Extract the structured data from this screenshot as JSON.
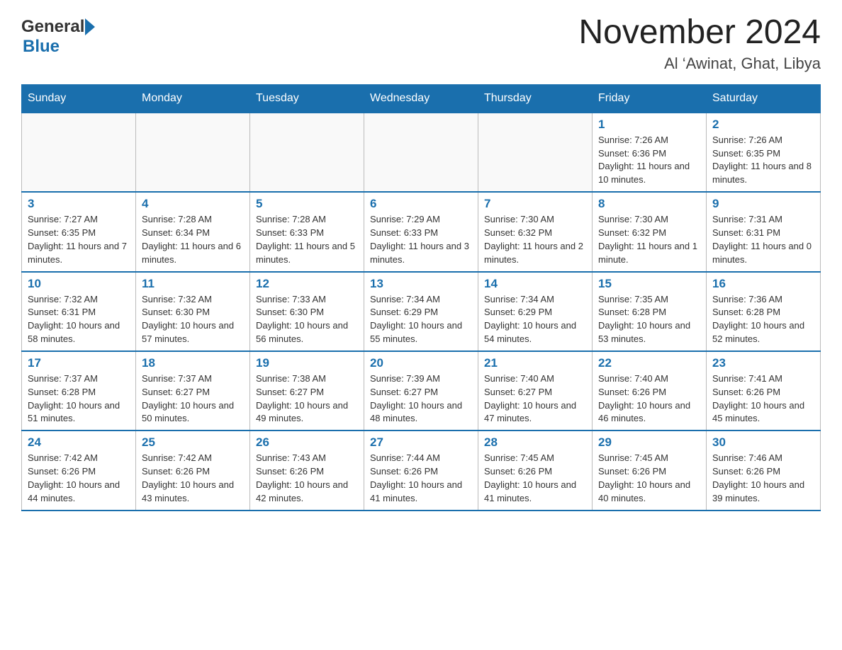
{
  "header": {
    "logo_general": "General",
    "logo_blue": "Blue",
    "month_title": "November 2024",
    "location": "Al ‘Awinat, Ghat, Libya"
  },
  "weekdays": [
    "Sunday",
    "Monday",
    "Tuesday",
    "Wednesday",
    "Thursday",
    "Friday",
    "Saturday"
  ],
  "weeks": [
    [
      {
        "day": "",
        "info": ""
      },
      {
        "day": "",
        "info": ""
      },
      {
        "day": "",
        "info": ""
      },
      {
        "day": "",
        "info": ""
      },
      {
        "day": "",
        "info": ""
      },
      {
        "day": "1",
        "info": "Sunrise: 7:26 AM\nSunset: 6:36 PM\nDaylight: 11 hours and 10 minutes."
      },
      {
        "day": "2",
        "info": "Sunrise: 7:26 AM\nSunset: 6:35 PM\nDaylight: 11 hours and 8 minutes."
      }
    ],
    [
      {
        "day": "3",
        "info": "Sunrise: 7:27 AM\nSunset: 6:35 PM\nDaylight: 11 hours and 7 minutes."
      },
      {
        "day": "4",
        "info": "Sunrise: 7:28 AM\nSunset: 6:34 PM\nDaylight: 11 hours and 6 minutes."
      },
      {
        "day": "5",
        "info": "Sunrise: 7:28 AM\nSunset: 6:33 PM\nDaylight: 11 hours and 5 minutes."
      },
      {
        "day": "6",
        "info": "Sunrise: 7:29 AM\nSunset: 6:33 PM\nDaylight: 11 hours and 3 minutes."
      },
      {
        "day": "7",
        "info": "Sunrise: 7:30 AM\nSunset: 6:32 PM\nDaylight: 11 hours and 2 minutes."
      },
      {
        "day": "8",
        "info": "Sunrise: 7:30 AM\nSunset: 6:32 PM\nDaylight: 11 hours and 1 minute."
      },
      {
        "day": "9",
        "info": "Sunrise: 7:31 AM\nSunset: 6:31 PM\nDaylight: 11 hours and 0 minutes."
      }
    ],
    [
      {
        "day": "10",
        "info": "Sunrise: 7:32 AM\nSunset: 6:31 PM\nDaylight: 10 hours and 58 minutes."
      },
      {
        "day": "11",
        "info": "Sunrise: 7:32 AM\nSunset: 6:30 PM\nDaylight: 10 hours and 57 minutes."
      },
      {
        "day": "12",
        "info": "Sunrise: 7:33 AM\nSunset: 6:30 PM\nDaylight: 10 hours and 56 minutes."
      },
      {
        "day": "13",
        "info": "Sunrise: 7:34 AM\nSunset: 6:29 PM\nDaylight: 10 hours and 55 minutes."
      },
      {
        "day": "14",
        "info": "Sunrise: 7:34 AM\nSunset: 6:29 PM\nDaylight: 10 hours and 54 minutes."
      },
      {
        "day": "15",
        "info": "Sunrise: 7:35 AM\nSunset: 6:28 PM\nDaylight: 10 hours and 53 minutes."
      },
      {
        "day": "16",
        "info": "Sunrise: 7:36 AM\nSunset: 6:28 PM\nDaylight: 10 hours and 52 minutes."
      }
    ],
    [
      {
        "day": "17",
        "info": "Sunrise: 7:37 AM\nSunset: 6:28 PM\nDaylight: 10 hours and 51 minutes."
      },
      {
        "day": "18",
        "info": "Sunrise: 7:37 AM\nSunset: 6:27 PM\nDaylight: 10 hours and 50 minutes."
      },
      {
        "day": "19",
        "info": "Sunrise: 7:38 AM\nSunset: 6:27 PM\nDaylight: 10 hours and 49 minutes."
      },
      {
        "day": "20",
        "info": "Sunrise: 7:39 AM\nSunset: 6:27 PM\nDaylight: 10 hours and 48 minutes."
      },
      {
        "day": "21",
        "info": "Sunrise: 7:40 AM\nSunset: 6:27 PM\nDaylight: 10 hours and 47 minutes."
      },
      {
        "day": "22",
        "info": "Sunrise: 7:40 AM\nSunset: 6:26 PM\nDaylight: 10 hours and 46 minutes."
      },
      {
        "day": "23",
        "info": "Sunrise: 7:41 AM\nSunset: 6:26 PM\nDaylight: 10 hours and 45 minutes."
      }
    ],
    [
      {
        "day": "24",
        "info": "Sunrise: 7:42 AM\nSunset: 6:26 PM\nDaylight: 10 hours and 44 minutes."
      },
      {
        "day": "25",
        "info": "Sunrise: 7:42 AM\nSunset: 6:26 PM\nDaylight: 10 hours and 43 minutes."
      },
      {
        "day": "26",
        "info": "Sunrise: 7:43 AM\nSunset: 6:26 PM\nDaylight: 10 hours and 42 minutes."
      },
      {
        "day": "27",
        "info": "Sunrise: 7:44 AM\nSunset: 6:26 PM\nDaylight: 10 hours and 41 minutes."
      },
      {
        "day": "28",
        "info": "Sunrise: 7:45 AM\nSunset: 6:26 PM\nDaylight: 10 hours and 41 minutes."
      },
      {
        "day": "29",
        "info": "Sunrise: 7:45 AM\nSunset: 6:26 PM\nDaylight: 10 hours and 40 minutes."
      },
      {
        "day": "30",
        "info": "Sunrise: 7:46 AM\nSunset: 6:26 PM\nDaylight: 10 hours and 39 minutes."
      }
    ]
  ]
}
